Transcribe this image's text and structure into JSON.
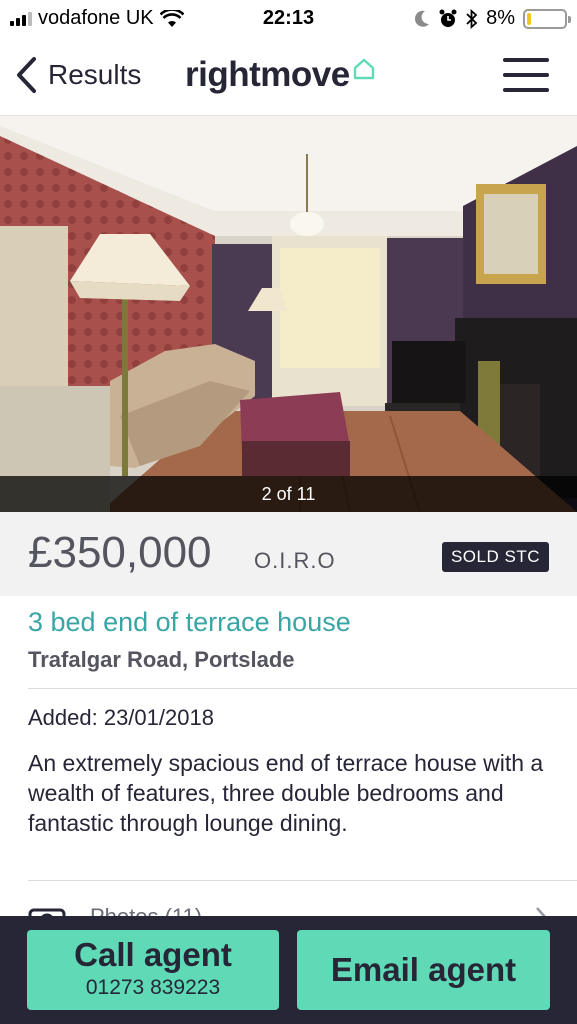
{
  "status_bar": {
    "carrier": "vodafone UK",
    "time": "22:13",
    "battery_percent": "8%",
    "battery_level": 0.08,
    "icons": [
      "signal-icon",
      "wifi-icon",
      "moon-icon",
      "alarm-icon",
      "bluetooth-icon",
      "battery-icon"
    ]
  },
  "nav": {
    "back_label": "Results",
    "logo_text": "rightmove",
    "menu_icon": "hamburger-menu-icon"
  },
  "photo": {
    "counter": "2 of 11"
  },
  "listing": {
    "price": "£350,000",
    "price_qualifier": "O.I.R.O",
    "status_badge": "SOLD STC",
    "title": "3 bed end of terrace house",
    "address": "Trafalgar Road, Portslade",
    "added": "Added: 23/01/2018",
    "summary": "An extremely spacious end of terrace house with a wealth of features, three double bedrooms and fantastic through lounge dining.",
    "photos_link": "Photos (11)"
  },
  "actions": {
    "call_label": "Call agent",
    "call_number": "01273 839223",
    "email_label": "Email agent"
  },
  "colors": {
    "brand_dark": "#262637",
    "accent_teal": "#3aa5a5",
    "button_green": "#5fd9b6",
    "battery_yellow": "#f5c518"
  }
}
